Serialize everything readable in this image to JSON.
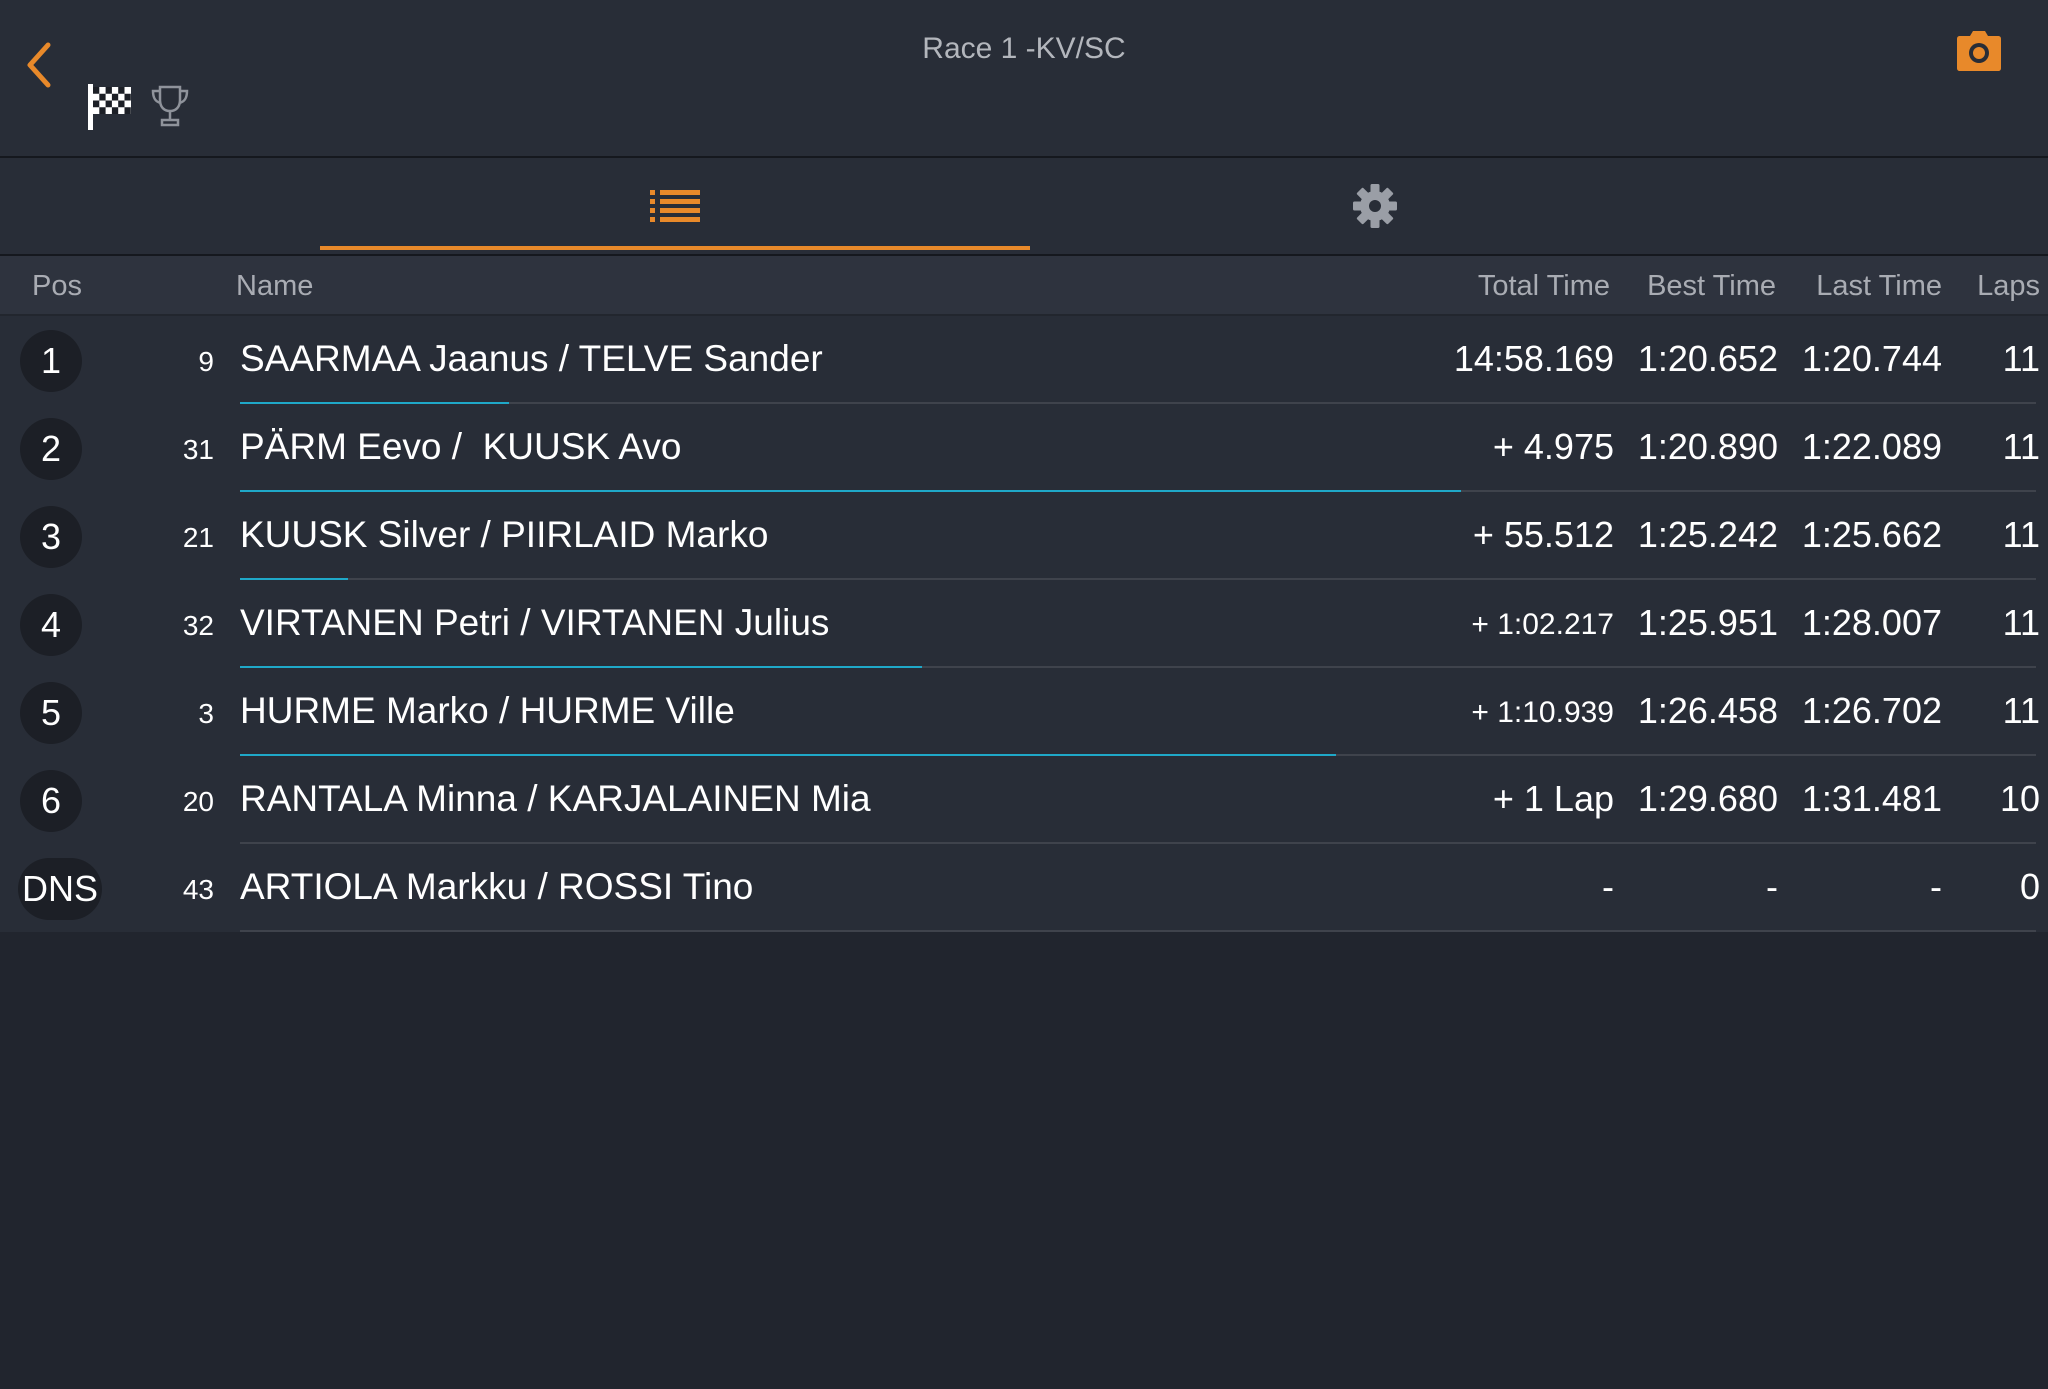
{
  "header": {
    "title": "Race 1 -KV/SC",
    "back_icon": "chevron-left-icon",
    "flag_icon": "checkered-flag-icon",
    "trophy_icon": "trophy-icon",
    "camera_icon": "camera-icon"
  },
  "tabs": [
    {
      "icon": "list-icon",
      "active": true
    },
    {
      "icon": "gear-icon",
      "active": false
    }
  ],
  "columns": {
    "pos": "Pos",
    "name": "Name",
    "total": "Total Time",
    "best": "Best Time",
    "last": "Last Time",
    "laps": "Laps"
  },
  "rows": [
    {
      "pos": "1",
      "num": "9",
      "name": "SAARMAA Jaanus / TELVE Sander",
      "total": "14:58.169",
      "best": "1:20.652",
      "last": "1:20.744",
      "laps": "11",
      "progress": 0.15
    },
    {
      "pos": "2",
      "num": "31",
      "name": "PÄRM Eevo /  KUUSK Avo",
      "total": "+ 4.975",
      "best": "1:20.890",
      "last": "1:22.089",
      "laps": "11",
      "progress": 0.68
    },
    {
      "pos": "3",
      "num": "21",
      "name": "KUUSK Silver / PIIRLAID Marko",
      "total": "+ 55.512",
      "best": "1:25.242",
      "last": "1:25.662",
      "laps": "11",
      "progress": 0.06
    },
    {
      "pos": "4",
      "num": "32",
      "name": "VIRTANEN Petri / VIRTANEN Julius",
      "total": "+ 1:02.217",
      "best": "1:25.951",
      "last": "1:28.007",
      "laps": "11",
      "progress": 0.38
    },
    {
      "pos": "5",
      "num": "3",
      "name": "HURME Marko / HURME Ville",
      "total": "+ 1:10.939",
      "best": "1:26.458",
      "last": "1:26.702",
      "laps": "11",
      "progress": 0.61
    },
    {
      "pos": "6",
      "num": "20",
      "name": "RANTALA Minna / KARJALAINEN Mia",
      "total": "+ 1 Lap",
      "best": "1:29.680",
      "last": "1:31.481",
      "laps": "10",
      "progress": 0
    },
    {
      "pos": "DNS",
      "num": "43",
      "name": "ARTIOLA Markku / ROSSI Tino",
      "total": "-",
      "best": "-",
      "last": "-",
      "laps": "0",
      "progress": 0
    }
  ],
  "colors": {
    "accent": "#e8892a",
    "progress_bar": "#1fa8c8"
  }
}
